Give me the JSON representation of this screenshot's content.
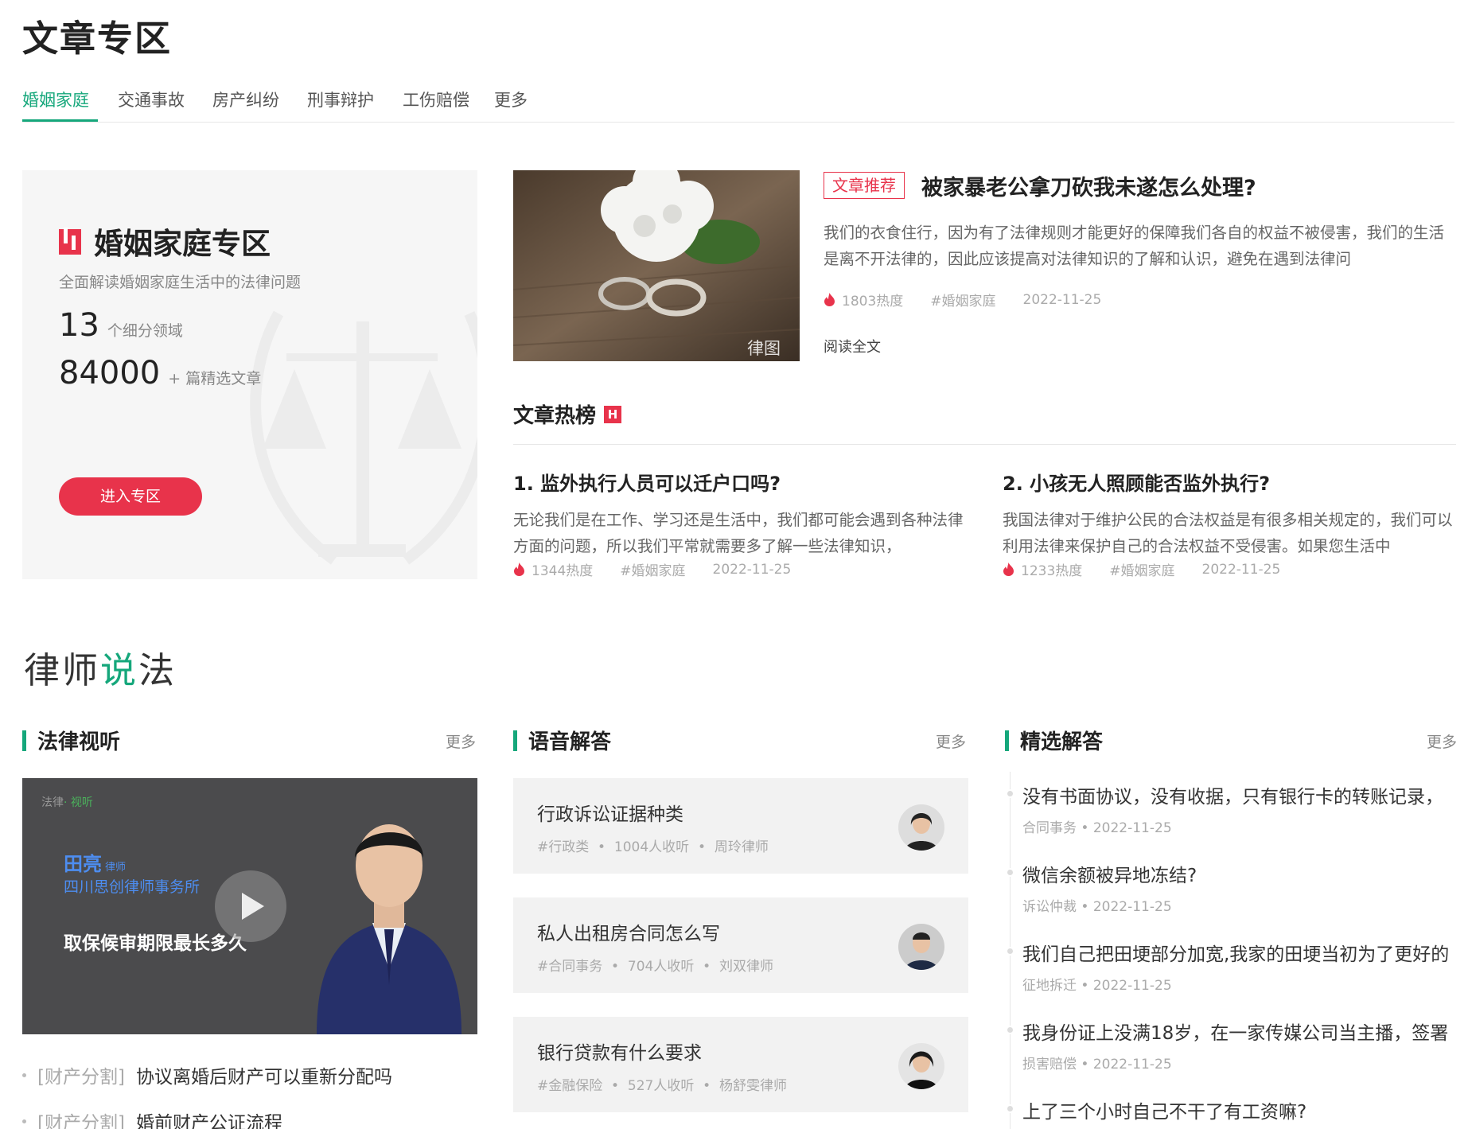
{
  "section_title": "文章专区",
  "tabs": [
    "婚姻家庭",
    "交通事故",
    "房产纠纷",
    "刑事辩护",
    "工伤赔偿",
    "更多"
  ],
  "zone": {
    "title": "婚姻家庭专区",
    "subtitle": "全面解读婚姻家庭生活中的法律问题",
    "count1": "13",
    "count1_unit": "个细分领域",
    "count2": "84000",
    "count2_unit": "+ 篇精选文章",
    "button": "进入专区"
  },
  "featured": {
    "badge": "文章推荐",
    "title": "被家暴老公拿刀砍我未遂怎么处理?",
    "desc": "我们的衣食住行，因为有了法律规则才能更好的保障我们各自的权益不被侵害，我们的生活是离不开法律的，因此应该提高对法律知识的了解和认识，避免在遇到法律问",
    "heat": "1803热度",
    "tag": "#婚姻家庭",
    "date": "2022-11-25",
    "read_more": "阅读全文",
    "watermark": "律图"
  },
  "hot": {
    "title": "文章热榜",
    "badge": "H",
    "items": [
      {
        "title": "1. 监外执行人员可以迁户口吗?",
        "desc": "无论我们是在工作、学习还是生活中，我们都可能会遇到各种法律方面的问题，所以我们平常就需要多了解一些法律知识，",
        "heat": "1344热度",
        "tag": "#婚姻家庭",
        "date": "2022-11-25"
      },
      {
        "title": "2. 小孩无人照顾能否监外执行?",
        "desc": "我国法律对于维护公民的合法权益是有很多相关规定的，我们可以利用法律来保护自己的合法权益不受侵害。如果您生活中",
        "heat": "1233热度",
        "tag": "#婚姻家庭",
        "date": "2022-11-25"
      }
    ]
  },
  "lawyer": {
    "title_a": "律师",
    "title_b": "说",
    "title_c": "法"
  },
  "col1": {
    "title": "法律视听",
    "more": "更多",
    "video": {
      "brand_a": "法律",
      "brand_b": "· 视听",
      "name": "田亮",
      "name_suffix": "律师",
      "firm": "四川思创律师事务所",
      "question": "取保候审期限最长多久"
    },
    "items": [
      {
        "cat": "[财产分割]",
        "title": "协议离婚后财产可以重新分配吗"
      },
      {
        "cat": "[财产分割]",
        "title": "婚前财产公证流程"
      }
    ]
  },
  "col2": {
    "title": "语音解答",
    "more": "更多",
    "items": [
      {
        "title": "行政诉讼证据种类",
        "tag": "#行政类",
        "listens": "1004人收听",
        "lawyer": "周玲律师"
      },
      {
        "title": "私人出租房合同怎么写",
        "tag": "#合同事务",
        "listens": "704人收听",
        "lawyer": "刘双律师"
      },
      {
        "title": "银行贷款有什么要求",
        "tag": "#金融保险",
        "listens": "527人收听",
        "lawyer": "杨舒雯律师"
      }
    ]
  },
  "col3": {
    "title": "精选解答",
    "more": "更多",
    "items": [
      {
        "title": "没有书面协议，没有收据，只有银行卡的转账记录，",
        "cat": "合同事务",
        "date": "2022-11-25"
      },
      {
        "title": "微信余额被异地冻结?",
        "cat": "诉讼仲裁",
        "date": "2022-11-25"
      },
      {
        "title": "我们自己把田埂部分加宽,我家的田埂当初为了更好的",
        "cat": "征地拆迁",
        "date": "2022-11-25"
      },
      {
        "title": "我身份证上没满18岁，在一家传媒公司当主播，签署",
        "cat": "损害赔偿",
        "date": "2022-11-25"
      },
      {
        "title": "上了三个小时自己不干了有工资嘛?",
        "cat": "",
        "date": ""
      }
    ]
  },
  "colors": {
    "green": "#15a77b",
    "red": "#e8334b"
  }
}
